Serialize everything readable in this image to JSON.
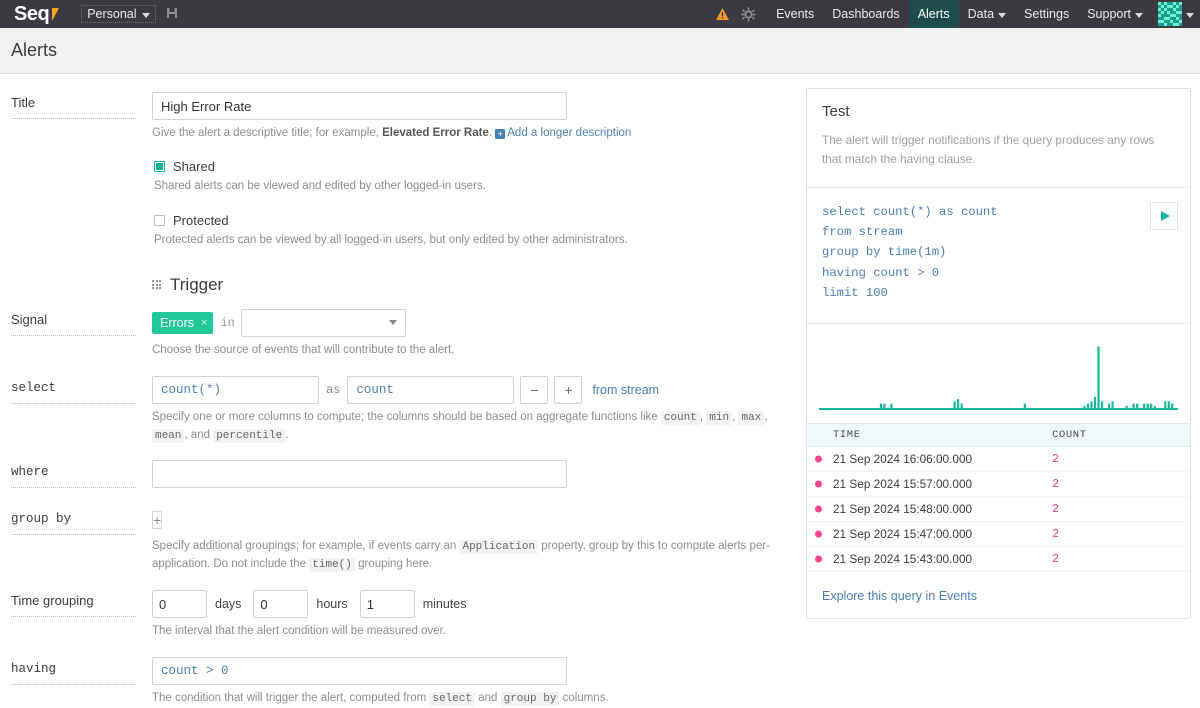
{
  "topnav": {
    "brand": "Seq",
    "workspace": "Personal",
    "workspace_caret_icon": "chevron-down-icon",
    "save_icon": "floppy-save-icon",
    "warning_icon": "warning-triangle-icon",
    "gear_icon": "gear-icon",
    "links": [
      {
        "label": "Events",
        "active": false,
        "caret": false
      },
      {
        "label": "Dashboards",
        "active": false,
        "caret": false
      },
      {
        "label": "Alerts",
        "active": true,
        "caret": false
      },
      {
        "label": "Data",
        "active": false,
        "caret": true
      },
      {
        "label": "Settings",
        "active": false,
        "caret": false
      },
      {
        "label": "Support",
        "active": false,
        "caret": true
      }
    ],
    "avatar_icon": "user-identicon-avatar",
    "avatar_caret_icon": "chevron-down-icon",
    "active_color": "#1e4b4b",
    "bar_color": "#3b3a40"
  },
  "page": {
    "title": "Alerts"
  },
  "form": {
    "title_row": {
      "label": "Title",
      "value": "High Error Rate",
      "placeholder": "",
      "hint_prefix": "Give the alert a descriptive title; for example, ",
      "hint_bold": "Elevated Error Rate",
      "hint_suffix": ".",
      "add_description_link": "Add a longer description",
      "add_description_icon": "plus-box-icon"
    },
    "shared": {
      "label": "Shared",
      "checked": true,
      "hint": "Shared alerts can be viewed and edited by other logged-in users."
    },
    "protected": {
      "label": "Protected",
      "checked": false,
      "hint": "Protected alerts can be viewed by all logged-in users, but only edited by other administrators."
    },
    "trigger": {
      "heading": "Trigger",
      "grip_icon": "drag-grip-icon"
    },
    "signal": {
      "label": "Signal",
      "tag": "Errors",
      "tag_remove_icon": "close-x-icon",
      "tag_color": "#20c997",
      "in_word": "in",
      "select_value": "",
      "select_caret_icon": "chevron-down-icon",
      "hint": "Choose the source of events that will contribute to the alert."
    },
    "select": {
      "label": "select",
      "expression": "count(*)",
      "as_word": "as",
      "alias": "count",
      "minus_label": "−",
      "plus_label": "+",
      "from_stream": "from stream",
      "hint_a": "Specify one or more columns to compute; the columns should be based on aggregate functions like ",
      "hint_codes": [
        "count",
        "min",
        "max",
        "mean",
        "percentile"
      ],
      "hint_b": ", and ",
      "hint_c": "."
    },
    "where": {
      "label": "where",
      "value": "",
      "placeholder": ""
    },
    "group_by": {
      "label": "group by",
      "add_label": "+",
      "hint_a": "Specify additional groupings; for example, if events carry an ",
      "hint_code_1": "Application",
      "hint_b": " property, group by this to compute alerts per-application. Do not include the ",
      "hint_code_2": "time()",
      "hint_c": " grouping here."
    },
    "time_grouping": {
      "label": "Time grouping",
      "days": "0",
      "days_unit": "days",
      "hours": "0",
      "hours_unit": "hours",
      "minutes": "1",
      "minutes_unit": "minutes",
      "hint": "The interval that the alert condition will be measured over."
    },
    "having": {
      "label": "having",
      "value": "count > 0",
      "hint_a": "The condition that will trigger the alert, computed from ",
      "hint_code_1": "select",
      "hint_b": " and ",
      "hint_code_2": "group by",
      "hint_c": " columns."
    }
  },
  "test_panel": {
    "heading": "Test",
    "description": "The alert will trigger notifications if the query produces any rows that match the having clause.",
    "query_lines": [
      "select count(*) as count",
      "from stream",
      "group by time(1m)",
      "having count > 0",
      "limit 100"
    ],
    "run_button_icon": "play-triangle-icon",
    "run_button_label": "",
    "table": {
      "columns": [
        "TIME",
        "COUNT"
      ],
      "rows": [
        {
          "time": "21 Sep 2024 16:06:00.000",
          "count": "2"
        },
        {
          "time": "21 Sep 2024 15:57:00.000",
          "count": "2"
        },
        {
          "time": "21 Sep 2024 15:48:00.000",
          "count": "2"
        },
        {
          "time": "21 Sep 2024 15:47:00.000",
          "count": "2"
        },
        {
          "time": "21 Sep 2024 15:43:00.000",
          "count": "2"
        }
      ]
    },
    "explore_link": "Explore this query in Events",
    "accent_color": "#15b89c",
    "count_color": "#e8418c"
  },
  "chart_data": {
    "type": "bar",
    "title": "",
    "xlabel": "",
    "ylabel": "",
    "grid": false,
    "legend": "none",
    "series_color": "#15b89c",
    "ylim": [
      0,
      30
    ],
    "x": [
      0,
      1,
      2,
      3,
      4,
      5,
      6,
      7,
      8,
      9,
      10,
      11,
      12,
      13,
      14,
      15,
      16,
      17,
      18,
      19,
      20,
      21,
      22,
      23,
      24,
      25,
      26,
      27,
      28,
      29,
      30,
      31,
      32,
      33,
      34,
      35,
      36,
      37,
      38,
      39,
      40,
      41,
      42,
      43,
      44,
      45,
      46,
      47,
      48,
      49,
      50,
      51,
      52,
      53,
      54,
      55,
      56,
      57,
      58,
      59,
      60,
      61,
      62,
      63,
      64,
      65,
      66,
      67,
      68,
      69,
      70,
      71,
      72,
      73,
      74,
      75,
      76,
      77,
      78,
      79,
      80,
      81,
      82,
      83,
      84,
      85,
      86,
      87,
      88,
      89,
      90,
      91,
      92,
      93,
      94,
      95,
      96,
      97,
      98,
      99
    ],
    "values": [
      0,
      0,
      0,
      0,
      0,
      0,
      0,
      0,
      0,
      0,
      0,
      0,
      0,
      0,
      0,
      0,
      2,
      2,
      0,
      2,
      0,
      0,
      0,
      0,
      0,
      0,
      0,
      0,
      0,
      0,
      0,
      0,
      0,
      0,
      0,
      0,
      0,
      3,
      4,
      2,
      0,
      0,
      0,
      0,
      0,
      0,
      0,
      0,
      0,
      0,
      0,
      0,
      0,
      0,
      0,
      0,
      0,
      2,
      0,
      0,
      0,
      0,
      0,
      0,
      0,
      0,
      0,
      0,
      0,
      0,
      0,
      0,
      0,
      0,
      1,
      2,
      3,
      5,
      28,
      3,
      0,
      2,
      3,
      0,
      0,
      0,
      1,
      0,
      2,
      2,
      0,
      2,
      2,
      2,
      1,
      0,
      0,
      3,
      3,
      2
    ]
  }
}
